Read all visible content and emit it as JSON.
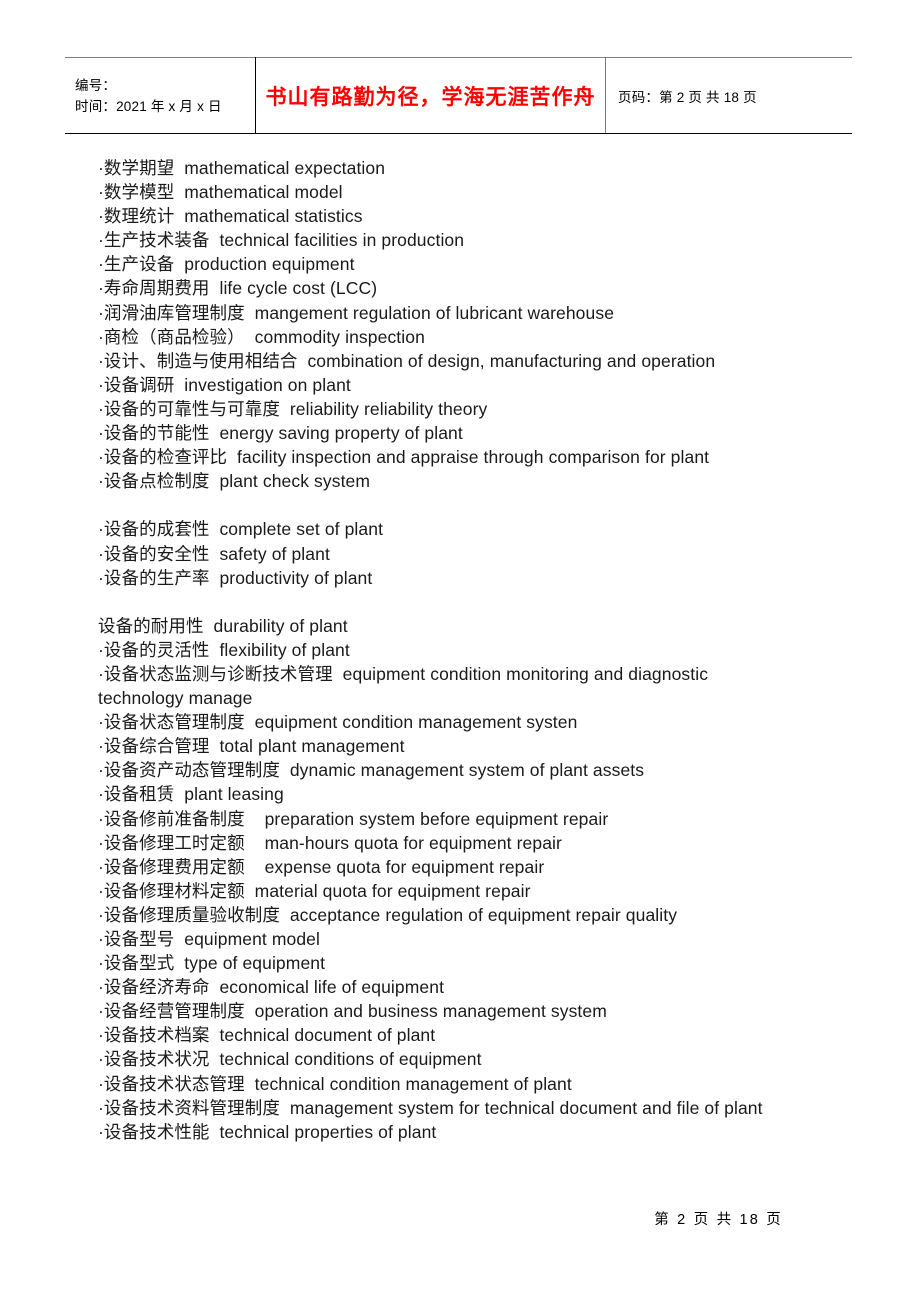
{
  "header": {
    "id_label": "编号：",
    "time_label": "时间：2021 年 x 月 x 日",
    "motto": "书山有路勤为径，学海无涯苦作舟",
    "motto_color": "#ff0000",
    "page_info": "页码：第 2 页 共 18 页"
  },
  "content": {
    "lines": [
      "·数学期望  mathematical expectation",
      "·数学模型  mathematical model",
      "·数理统计  mathematical statistics",
      "·生产技术装备  technical facilities in production",
      "·生产设备  production equipment",
      "·寿命周期费用  life cycle cost (LCC)",
      "·润滑油库管理制度  mangement regulation of lubricant warehouse",
      "·商检（商品检验）  commodity inspection",
      "·设计、制造与使用相结合  combination of design, manufacturing and operation",
      "·设备调研  investigation on plant",
      "·设备的可靠性与可靠度  reliability reliability theory",
      "·设备的节能性  energy saving property of plant",
      "·设备的检查评比  facility inspection and appraise through comparison for plant",
      "·设备点检制度  plant check system",
      "",
      "·设备的成套性  complete set of plant",
      "·设备的安全性  safety of plant",
      "·设备的生产率  productivity of plant",
      "",
      "设备的耐用性  durability of plant",
      "·设备的灵活性  flexibility of plant",
      "·设备状态监测与诊断技术管理  equipment condition monitoring and diagnostic technology manage",
      "·设备状态管理制度  equipment condition management systen",
      "·设备综合管理  total plant management",
      "·设备资产动态管理制度  dynamic management system of plant assets",
      "·设备租赁  plant leasing",
      "·设备修前准备制度    preparation system before equipment repair",
      "·设备修理工时定额    man-hours quota for equipment repair",
      "·设备修理费用定额    expense quota for equipment repair",
      "·设备修理材料定额  material quota for equipment repair",
      "·设备修理质量验收制度  acceptance regulation of equipment repair quality",
      "·设备型号  equipment model",
      "·设备型式  type of equipment",
      "·设备经济寿命  economical life of equipment",
      "·设备经营管理制度  operation and business management system",
      "·设备技术档案  technical document of plant",
      "·设备技术状况  technical conditions of equipment",
      "·设备技术状态管理  technical condition management of plant",
      "·设备技术资料管理制度  management system for technical document and file of plant",
      "·设备技术性能  technical properties of plant"
    ]
  },
  "footer": {
    "page_text": "第 2 页 共 18 页"
  }
}
